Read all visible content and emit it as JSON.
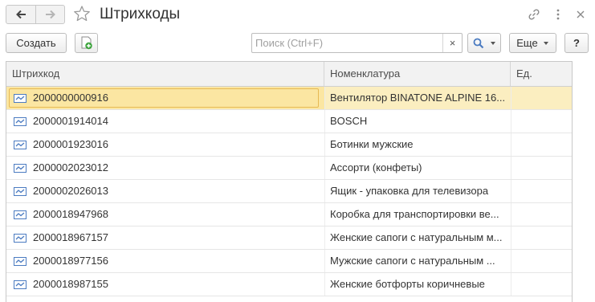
{
  "title": "Штрихкоды",
  "toolbar": {
    "create_label": "Создать",
    "search_placeholder": "Поиск (Ctrl+F)",
    "search_clear": "×",
    "more_label": "Еще",
    "help_label": "?"
  },
  "table": {
    "columns": [
      "Штрихкод",
      "Номенклатура",
      "Ед."
    ],
    "rows": [
      {
        "code": "2000000000916",
        "nom": "Вентилятор BINATONE ALPINE 16...",
        "unit": ""
      },
      {
        "code": "2000001914014",
        "nom": "BOSCH",
        "unit": ""
      },
      {
        "code": "2000001923016",
        "nom": "Ботинки мужские",
        "unit": ""
      },
      {
        "code": "2000002023012",
        "nom": "Ассорти (конфеты)",
        "unit": ""
      },
      {
        "code": "2000002026013",
        "nom": "Ящик - упаковка для телевизора",
        "unit": ""
      },
      {
        "code": "2000018947968",
        "nom": "Коробка для транспортировки ве...",
        "unit": ""
      },
      {
        "code": "2000018967157",
        "nom": "Женские сапоги с натуральным м...",
        "unit": ""
      },
      {
        "code": "2000018977156",
        "nom": "Мужские сапоги с натуральным ...",
        "unit": ""
      },
      {
        "code": "2000018987155",
        "nom": "Женские ботфорты коричневые",
        "unit": ""
      }
    ],
    "selected_row": 0
  },
  "icons": {
    "back": "arrow-left-icon",
    "forward": "arrow-right-icon",
    "favorite": "star-icon",
    "link": "link-icon",
    "more_vertical": "vertical-dots-icon",
    "close": "close-icon",
    "add_copy": "add-document-icon",
    "search": "magnifier-icon",
    "row": "barcode-icon"
  },
  "colors": {
    "selected_row": "#fbeec0",
    "selected_cell": "#fbe6a2",
    "header_bg": "#f2f2f2",
    "accent_blue": "#4b7bc1",
    "add_green": "#3aa33a"
  }
}
